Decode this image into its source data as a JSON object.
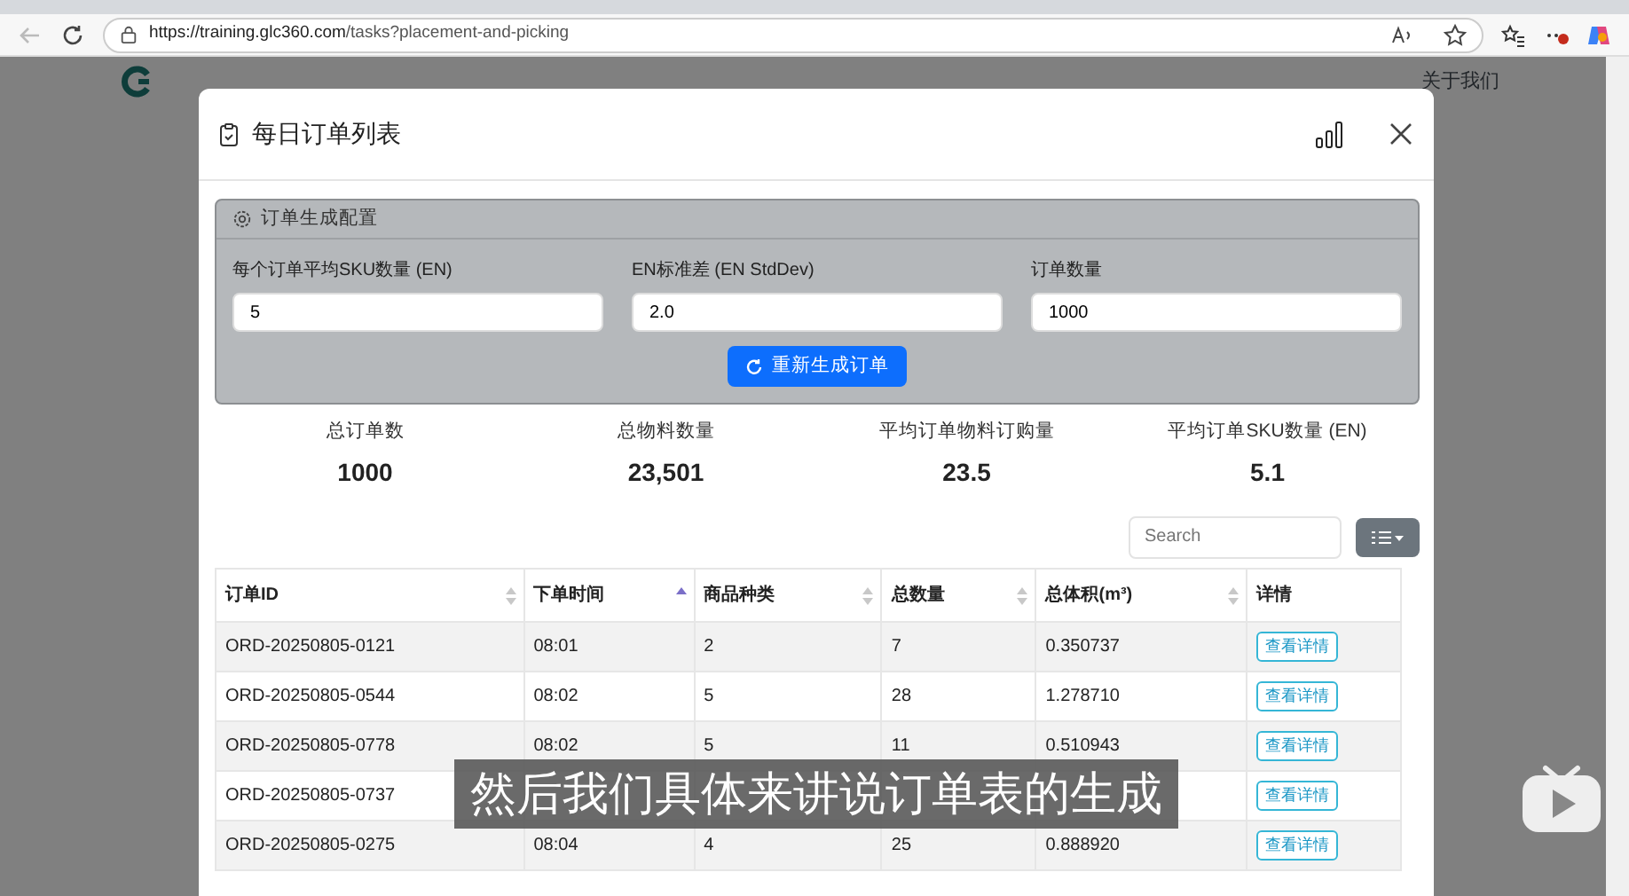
{
  "browser": {
    "url_host": "https://training.glc360.com",
    "url_path": "/tasks?placement-and-picking"
  },
  "site_nav": {
    "links": [
      "关于我们"
    ]
  },
  "modal": {
    "title": "每日订单列表"
  },
  "config": {
    "title": "订单生成配置",
    "button": "重新生成订单",
    "fields": [
      {
        "label": "每个订单平均SKU数量 (EN)",
        "value": "5"
      },
      {
        "label": "EN标准差 (EN StdDev)",
        "value": "2.0"
      },
      {
        "label": "订单数量",
        "value": "1000"
      }
    ]
  },
  "stats": [
    {
      "label": "总订单数",
      "value": "1000"
    },
    {
      "label": "总物料数量",
      "value": "23,501"
    },
    {
      "label": "平均订单物料订购量",
      "value": "23.5"
    },
    {
      "label": "平均订单SKU数量 (EN)",
      "value": "5.1"
    }
  ],
  "search": {
    "placeholder": "Search"
  },
  "table": {
    "columns": [
      {
        "label": "订单ID",
        "sorted": false
      },
      {
        "label": "下单时间",
        "sorted": true
      },
      {
        "label": "商品种类",
        "sorted": false
      },
      {
        "label": "总数量",
        "sorted": false
      },
      {
        "label": "总体积(m³)",
        "sorted": false
      },
      {
        "label": "详情"
      }
    ],
    "rows": [
      {
        "cells": [
          "ORD-20250805-0121",
          "08:01",
          "2",
          "7",
          "0.350737"
        ],
        "action": "查看详情"
      },
      {
        "cells": [
          "ORD-20250805-0544",
          "08:02",
          "5",
          "28",
          "1.278710"
        ],
        "action": "查看详情"
      },
      {
        "cells": [
          "ORD-20250805-0778",
          "08:02",
          "5",
          "11",
          "0.510943"
        ],
        "action": "查看详情"
      },
      {
        "cells": [
          "ORD-20250805-0737",
          null,
          null,
          null,
          null
        ],
        "action": "查看详情"
      },
      {
        "cells": [
          "ORD-20250805-0275",
          "08:04",
          "4",
          "25",
          "0.888920"
        ],
        "action": "查看详情"
      }
    ]
  },
  "subtitle": "然后我们具体来讲说订单表的生成"
}
